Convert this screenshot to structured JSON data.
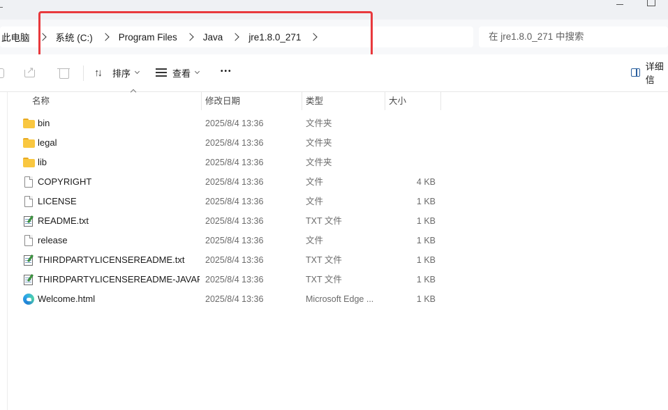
{
  "breadcrumb": {
    "items": [
      "此电脑",
      "系统 (C:)",
      "Program Files",
      "Java",
      "jre1.8.0_271"
    ]
  },
  "search": {
    "placeholder": "在 jre1.8.0_271 中搜索"
  },
  "toolbar": {
    "sort_label": "排序",
    "view_label": "查看",
    "more_label": "•••",
    "details_label": "详细信"
  },
  "columns": {
    "name": "名称",
    "date": "修改日期",
    "type": "类型",
    "size": "大小"
  },
  "files": [
    {
      "name": "bin",
      "date": "2025/8/4 13:36",
      "type": "文件夹",
      "size": "",
      "icon": "folder-icon"
    },
    {
      "name": "legal",
      "date": "2025/8/4 13:36",
      "type": "文件夹",
      "size": "",
      "icon": "folder-icon"
    },
    {
      "name": "lib",
      "date": "2025/8/4 13:36",
      "type": "文件夹",
      "size": "",
      "icon": "folder-icon"
    },
    {
      "name": "COPYRIGHT",
      "date": "2025/8/4 13:36",
      "type": "文件",
      "size": "4 KB",
      "icon": "file-icon"
    },
    {
      "name": "LICENSE",
      "date": "2025/8/4 13:36",
      "type": "文件",
      "size": "1 KB",
      "icon": "file-icon"
    },
    {
      "name": "README.txt",
      "date": "2025/8/4 13:36",
      "type": "TXT 文件",
      "size": "1 KB",
      "icon": "text-file-icon"
    },
    {
      "name": "release",
      "date": "2025/8/4 13:36",
      "type": "文件",
      "size": "1 KB",
      "icon": "file-icon"
    },
    {
      "name": "THIRDPARTYLICENSEREADME.txt",
      "date": "2025/8/4 13:36",
      "type": "TXT 文件",
      "size": "1 KB",
      "icon": "text-file-icon"
    },
    {
      "name": "THIRDPARTYLICENSEREADME-JAVAF...",
      "date": "2025/8/4 13:36",
      "type": "TXT 文件",
      "size": "1 KB",
      "icon": "text-file-icon"
    },
    {
      "name": "Welcome.html",
      "date": "2025/8/4 13:36",
      "type": "Microsoft Edge ...",
      "size": "1 KB",
      "icon": "edge-html-icon"
    }
  ],
  "colors": {
    "highlight": "#e8393d",
    "folder": "#f9c740",
    "details_accent": "#2a5f9e"
  }
}
